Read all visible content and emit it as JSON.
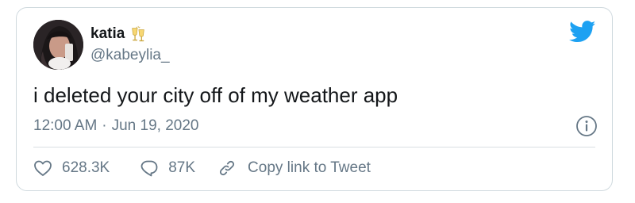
{
  "user": {
    "display_name": "katia",
    "handle": "@kabeylia_"
  },
  "tweet": {
    "text": "i deleted your city off of my weather app",
    "time": "12:00 AM",
    "separator": "·",
    "date": "Jun 19, 2020"
  },
  "actions": {
    "likes": "628.3K",
    "replies": "87K",
    "copy_link_label": "Copy link to Tweet"
  },
  "colors": {
    "brand": "#1da1f2",
    "secondary_text": "#657786",
    "border": "#cfd9de"
  },
  "icons": [
    "clinking-glasses-icon",
    "twitter-bird-icon",
    "info-icon",
    "heart-icon",
    "reply-icon",
    "link-icon"
  ]
}
